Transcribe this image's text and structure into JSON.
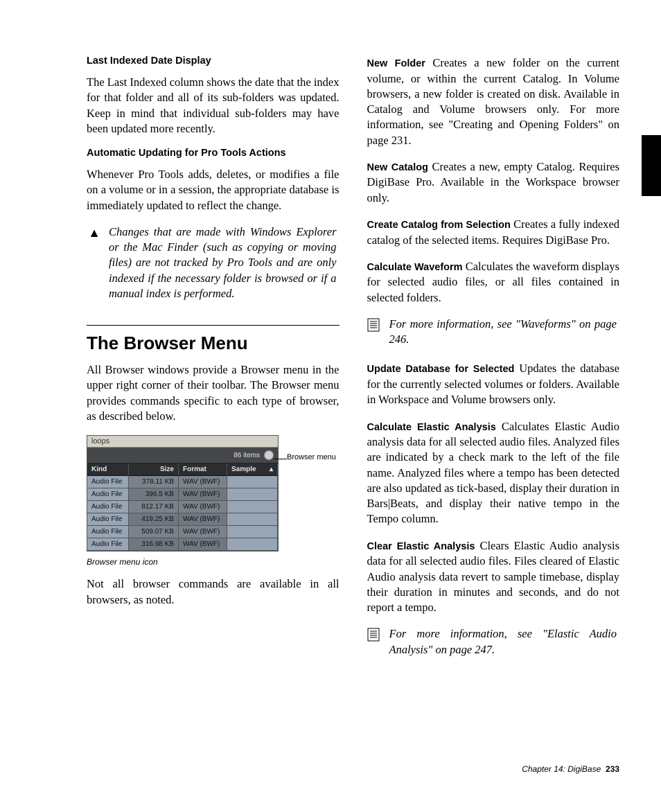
{
  "left": {
    "sub1": "Last Indexed Date Display",
    "p1": "The Last Indexed column shows the date that the index for that folder and all of its sub-folders was updated. Keep in mind that individual sub-folders may have been updated more recently.",
    "sub2": "Automatic Updating for Pro Tools Actions",
    "p2": "Whenever Pro Tools adds, deletes, or modifies a file on a volume or in a session, the appropriate database is immediately updated to reflect the change.",
    "warn": "Changes that are made with Windows Explorer or the Mac Finder (such as copying or moving files) are not tracked by Pro Tools and are only indexed if the necessary folder is browsed or if a manual index is performed.",
    "h2": "The Browser Menu",
    "p3": "All Browser windows provide a Browser menu in the upper right corner of their toolbar. The Browser menu provides commands specific to each type of browser, as described below.",
    "p4": "Not all browser commands are available in all browsers, as noted."
  },
  "figure": {
    "title": "loops",
    "items": "86 items",
    "headers": {
      "kind": "Kind",
      "size": "Size",
      "format": "Format",
      "sample": "Sample"
    },
    "rows": [
      {
        "kind": "Audio File",
        "size": "378.11 KB",
        "format": "WAV (BWF)"
      },
      {
        "kind": "Audio File",
        "size": "396.5 KB",
        "format": "WAV (BWF)"
      },
      {
        "kind": "Audio File",
        "size": "812.17 KB",
        "format": "WAV (BWF)"
      },
      {
        "kind": "Audio File",
        "size": "419.25 KB",
        "format": "WAV (BWF)"
      },
      {
        "kind": "Audio File",
        "size": "509.07 KB",
        "format": "WAV (BWF)"
      },
      {
        "kind": "Audio File",
        "size": "316.98 KB",
        "format": "WAV (BWF)"
      }
    ],
    "callout": "Browser menu",
    "caption": "Browser menu icon"
  },
  "right": {
    "nf_label": "New Folder",
    "nf": " Creates a new folder on the current volume, or within the current Catalog. In Volume browsers, a new folder is created on disk. Available in Catalog and Volume browsers only. For more information, see \"Creating and Opening Folders\" on page 231.",
    "nc_label": "New Catalog",
    "nc": " Creates a new, empty Catalog. Requires DigiBase Pro. Available in the Workspace browser only.",
    "ccs_label": "Create Catalog from Selection",
    "ccs": " Creates a fully indexed catalog of the selected items. Requires DigiBase Pro.",
    "cw_label": "Calculate Waveform",
    "cw": " Calculates the waveform displays for selected audio files, or all files contained in selected folders.",
    "note1": "For more information, see \"Waveforms\" on page 246.",
    "uds_label": "Update Database for Selected",
    "uds": " Updates the database for the currently selected volumes or folders. Available in Workspace and Volume browsers only.",
    "cea_label": "Calculate Elastic Analysis",
    "cea": " Calculates Elastic Audio analysis data for all selected audio files. Analyzed files are indicated by a check mark to the left of the file name. Analyzed files where a tempo has been detected are also updated as tick-based, display their duration in Bars|Beats, and display their native tempo in the Tempo column.",
    "clea_label": "Clear Elastic Analysis",
    "clea": " Clears Elastic Audio analysis data for all selected audio files. Files cleared of Elastic Audio analysis data revert to sample timebase, display their duration in minutes and seconds, and do not report a tempo.",
    "note2": "For more information, see \"Elastic Audio Analysis\" on page 247."
  },
  "footer": {
    "chapter": "Chapter 14: DigiBase",
    "page": "233"
  }
}
